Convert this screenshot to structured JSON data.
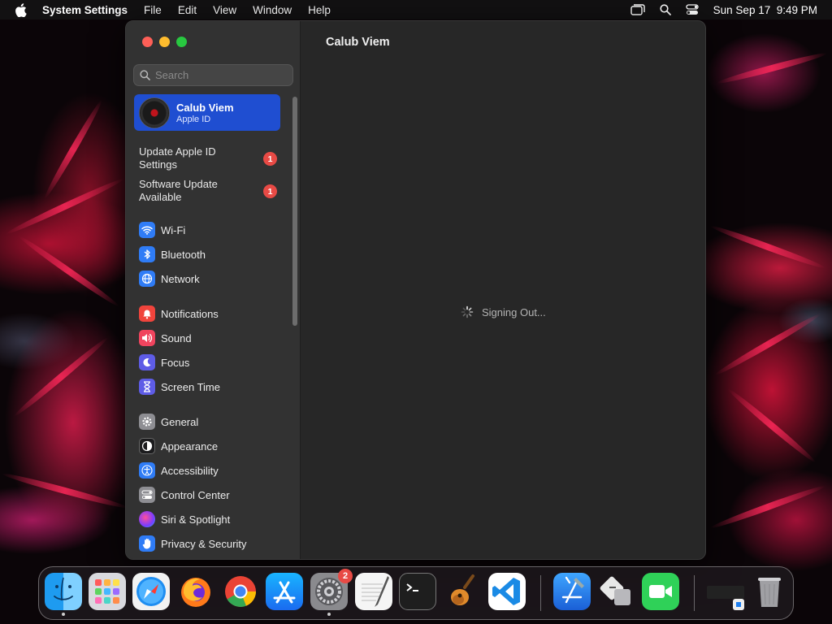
{
  "menubar": {
    "app_name": "System Settings",
    "menus": [
      "File",
      "Edit",
      "View",
      "Window",
      "Help"
    ],
    "clock": "Sun Sep 17  9:49 PM"
  },
  "window": {
    "search_placeholder": "Search",
    "account": {
      "name": "Calub Viem",
      "subtitle": "Apple ID"
    },
    "notices": [
      {
        "label": "Update Apple ID Settings",
        "badge": "1"
      },
      {
        "label": "Software Update Available",
        "badge": "1"
      }
    ],
    "groups": [
      [
        {
          "label": "Wi-Fi",
          "icon": "wifi-icon",
          "color": "#2f7cf6"
        },
        {
          "label": "Bluetooth",
          "icon": "bluetooth-icon",
          "color": "#2f7cf6"
        },
        {
          "label": "Network",
          "icon": "network-icon",
          "color": "#2f7cf6"
        }
      ],
      [
        {
          "label": "Notifications",
          "icon": "notifications-icon",
          "color": "#f0443c"
        },
        {
          "label": "Sound",
          "icon": "sound-icon",
          "color": "#f0445e"
        },
        {
          "label": "Focus",
          "icon": "focus-icon",
          "color": "#5e5ce6"
        },
        {
          "label": "Screen Time",
          "icon": "screen-time-icon",
          "color": "#5e5ce6"
        }
      ],
      [
        {
          "label": "General",
          "icon": "general-icon",
          "color": "#8e8e93"
        },
        {
          "label": "Appearance",
          "icon": "appearance-icon",
          "color": "#1c1c1e"
        },
        {
          "label": "Accessibility",
          "icon": "accessibility-icon",
          "color": "#2f7cf6"
        },
        {
          "label": "Control Center",
          "icon": "control-center-icon",
          "color": "#8e8e93"
        },
        {
          "label": "Siri & Spotlight",
          "icon": "siri-icon",
          "color": "#b24ccf"
        },
        {
          "label": "Privacy & Security",
          "icon": "privacy-icon",
          "color": "#2f7cf6"
        }
      ]
    ],
    "content_title": "Calub Viem",
    "status_text": "Signing Out..."
  },
  "dock": {
    "apps": [
      {
        "name": "Finder",
        "icon": "finder-icon",
        "running": true
      },
      {
        "name": "Launchpad",
        "icon": "launchpad-icon",
        "running": false
      },
      {
        "name": "Safari",
        "icon": "safari-icon",
        "running": false
      },
      {
        "name": "Firefox",
        "icon": "firefox-icon",
        "running": false
      },
      {
        "name": "Chrome",
        "icon": "chrome-icon",
        "running": false
      },
      {
        "name": "App Store",
        "icon": "app-store-icon",
        "running": false
      },
      {
        "name": "System Settings",
        "icon": "system-settings-icon",
        "running": true,
        "badge": "2"
      },
      {
        "name": "TextEdit",
        "icon": "textedit-icon",
        "running": false
      },
      {
        "name": "Terminal",
        "icon": "terminal-icon",
        "running": false
      },
      {
        "name": "GarageBand",
        "icon": "garageband-icon",
        "running": false
      },
      {
        "name": "Visual Studio Code",
        "icon": "vscode-icon",
        "running": false
      },
      {
        "name": "Xcode",
        "icon": "xcode-icon",
        "running": false
      },
      {
        "name": "Migration Assistant",
        "icon": "migration-icon",
        "running": false
      },
      {
        "name": "FaceTime",
        "icon": "facetime-icon",
        "running": false
      },
      {
        "name": "Downloads",
        "icon": "downloads-stack-icon",
        "running": false
      },
      {
        "name": "Trash",
        "icon": "trash-icon",
        "running": false
      }
    ]
  }
}
